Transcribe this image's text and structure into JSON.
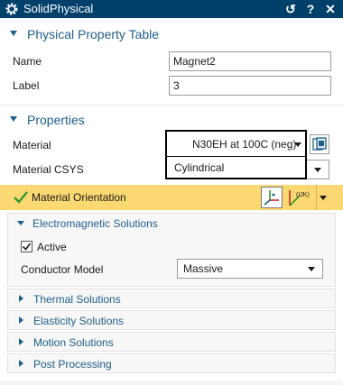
{
  "window": {
    "title": "SolidPhysical",
    "buttons": {
      "reset": "↺",
      "help": "?",
      "close": "✕"
    }
  },
  "physical_property_table": {
    "header": "Physical Property Table",
    "name_label": "Name",
    "name_value": "Magnet2",
    "label_label": "Label",
    "label_value": "3"
  },
  "properties": {
    "header": "Properties",
    "material_label": "Material",
    "material_value": "N30EH at 100C (neg)",
    "material_csys_label": "Material CSYS",
    "material_csys_value": "Cylindrical",
    "orientation_label": "Material Orientation",
    "orientation_status": "complete"
  },
  "electromagnetic": {
    "header": "Electromagnetic Solutions",
    "active_label": "Active",
    "active_checked": true,
    "conductor_model_label": "Conductor Model",
    "conductor_model_value": "Massive"
  },
  "collapsed_sections": [
    {
      "label": "Thermal Solutions"
    },
    {
      "label": "Elasticity Solutions"
    },
    {
      "label": "Motion Solutions"
    },
    {
      "label": "Post Processing"
    }
  ],
  "icons": {
    "settings": "gear-icon",
    "material_library": "material-library-icon",
    "csys": "csys-axes-icon",
    "orientation_vector": "orientation-vector-icon",
    "check": "checkmark-icon"
  },
  "colors": {
    "titlebar": "#00406b",
    "section_header": "#1e5f8a",
    "highlight_bar": "#fbd872",
    "check": "#2e9b2e"
  }
}
